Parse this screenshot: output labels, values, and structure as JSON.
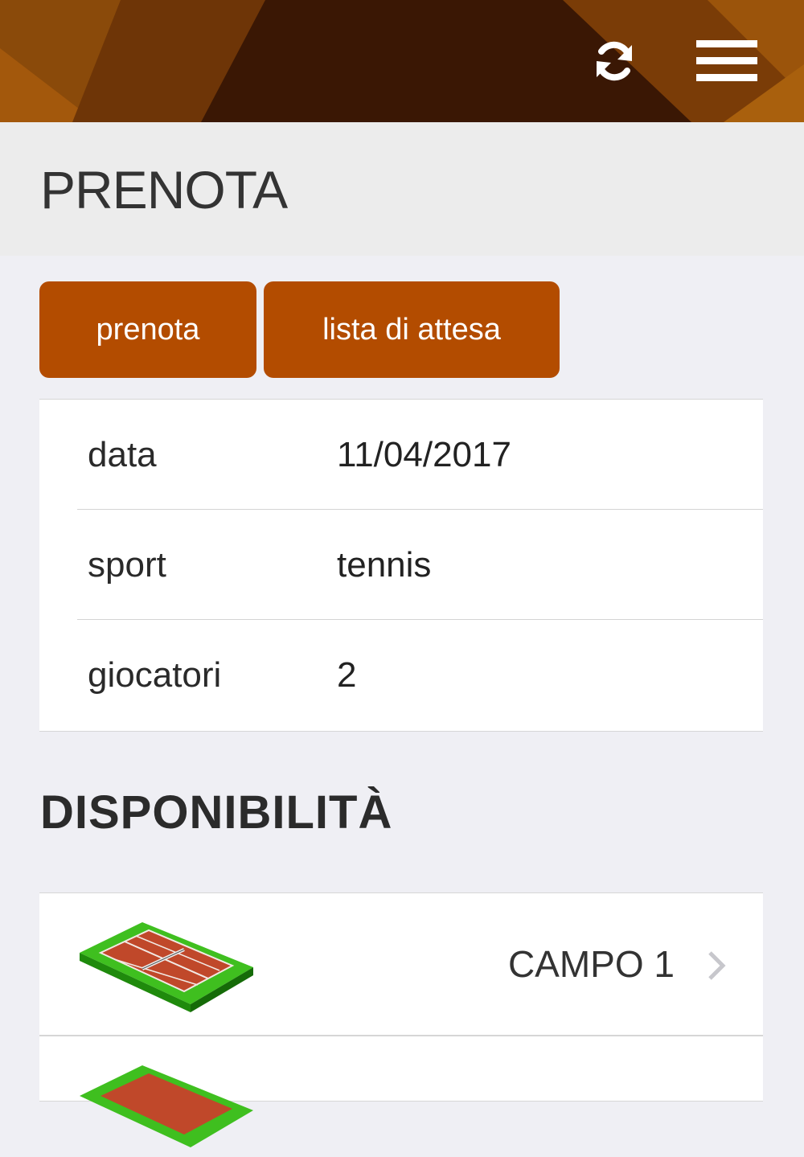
{
  "header": {
    "refresh_icon": "refresh-icon",
    "menu_icon": "hamburger-menu-icon",
    "colors": {
      "dark": "#3d1a06",
      "mid": "#7a3d08",
      "light": "#b8620c"
    }
  },
  "page": {
    "title": "PRENOTA"
  },
  "tabs": {
    "prenota_label": "prenota",
    "lista_label": "lista di attesa",
    "color": "#b34c00"
  },
  "info": {
    "rows": [
      {
        "label": "data",
        "value": "11/04/2017"
      },
      {
        "label": "sport",
        "value": "tennis"
      },
      {
        "label": "giocatori",
        "value": "2"
      }
    ]
  },
  "availability": {
    "title": "DISPONIBILITÀ",
    "courts": [
      {
        "label": "CAMPO 1",
        "icon": "tennis-court-icon"
      },
      {
        "label": "",
        "icon": "tennis-court-icon"
      }
    ]
  }
}
